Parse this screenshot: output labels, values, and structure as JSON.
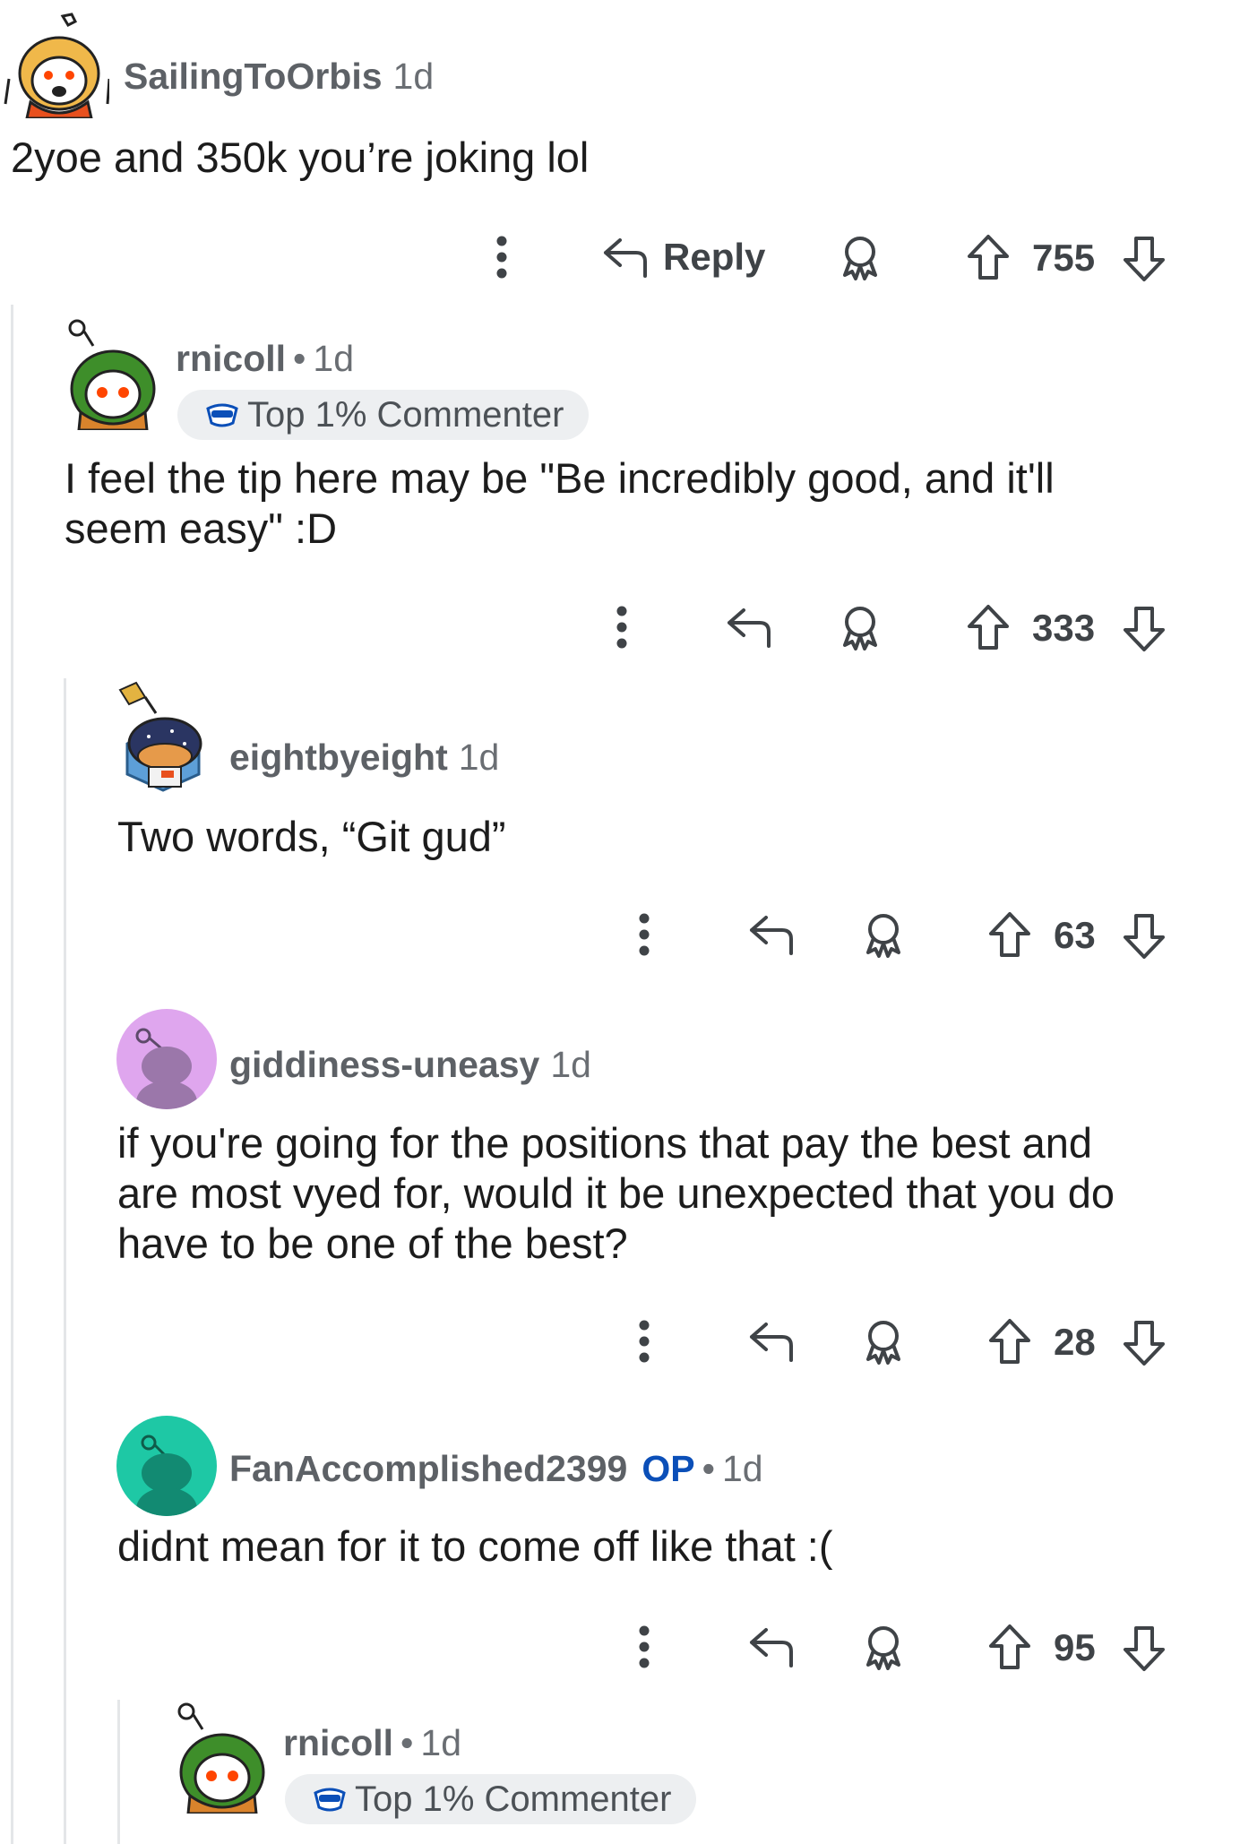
{
  "comments": [
    {
      "username": "SailingToOrbis",
      "age": "1d",
      "body": [
        "2yoe and 350k you’re joking lol"
      ],
      "reply_label": "Reply",
      "score": "755"
    },
    {
      "username": "rnicoll",
      "separator": "•",
      "age": "1d",
      "badge": "Top 1% Commenter",
      "body": [
        "I feel the tip here may be \"Be incredibly good, and it'll",
        "seem easy\" :D"
      ],
      "score": "333"
    },
    {
      "username": "eightbyeight",
      "age": "1d",
      "body": [
        "Two words, “Git gud”"
      ],
      "score": "63"
    },
    {
      "username": "giddiness-uneasy",
      "age": "1d",
      "body": [
        "if you're going for the positions that pay the best and",
        "are most vyed for, would it be unexpected that you do",
        "have to be one of the best?"
      ],
      "score": "28"
    },
    {
      "username": "FanAccomplished2399",
      "op_label": "OP",
      "separator": "•",
      "age": "1d",
      "body": [
        "didnt mean for it to come off like that :("
      ],
      "score": "95"
    },
    {
      "username": "rnicoll",
      "separator": "•",
      "age": "1d",
      "badge": "Top 1% Commenter"
    }
  ],
  "icons": {
    "more": "more-vertical-icon",
    "reply": "reply-arrow-icon",
    "award": "award-icon",
    "upvote": "upvote-arrow-icon",
    "downvote": "downvote-arrow-icon",
    "badge": "commenter-badge-icon"
  },
  "colors": {
    "op": "#0b4fb8",
    "thread_line": "#e4e6e8",
    "badge_bg": "#edeff1",
    "avatar_purple": "#dfa6ee",
    "avatar_teal": "#1ec8a5"
  }
}
